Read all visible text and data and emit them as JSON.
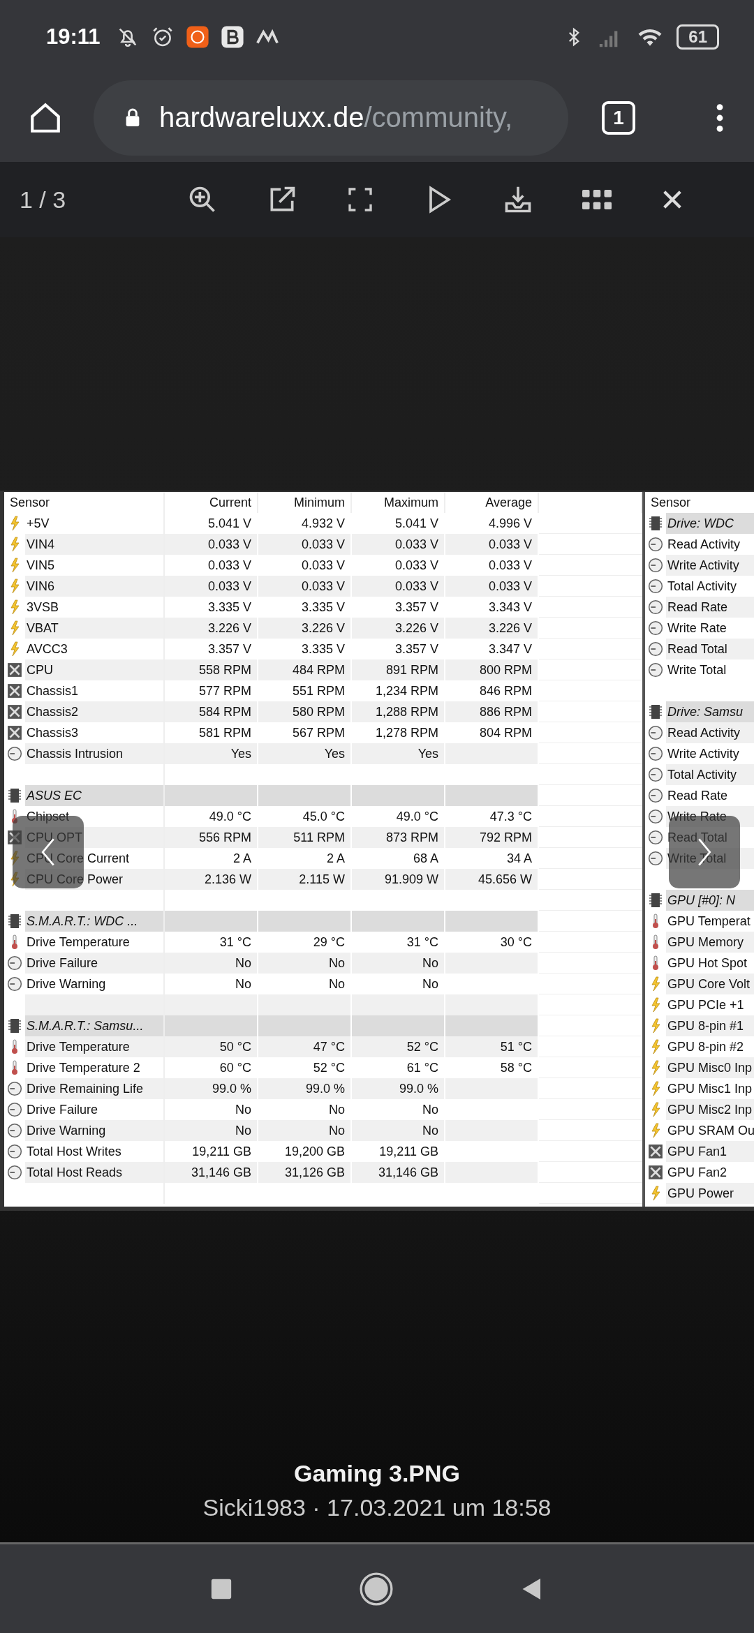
{
  "status_bar": {
    "time": "19:11",
    "battery": "61"
  },
  "address_bar": {
    "domain": "hardwareluxx.de",
    "path": "/community,",
    "tab_count": "1"
  },
  "viewer": {
    "counter": "1 / 3",
    "caption": "Gaming 3.PNG",
    "meta": "Sicki1983 · 17.03.2021 um 18:58"
  },
  "left_panel": {
    "columns": [
      "Sensor",
      "Current",
      "Minimum",
      "Maximum",
      "Average"
    ],
    "rows": [
      {
        "kind": "voltage",
        "name": "+5V",
        "values": [
          "5.041 V",
          "4.932 V",
          "5.041 V",
          "4.996 V"
        ]
      },
      {
        "kind": "voltage",
        "name": "VIN4",
        "values": [
          "0.033 V",
          "0.033 V",
          "0.033 V",
          "0.033 V"
        ]
      },
      {
        "kind": "voltage",
        "name": "VIN5",
        "values": [
          "0.033 V",
          "0.033 V",
          "0.033 V",
          "0.033 V"
        ]
      },
      {
        "kind": "voltage",
        "name": "VIN6",
        "values": [
          "0.033 V",
          "0.033 V",
          "0.033 V",
          "0.033 V"
        ]
      },
      {
        "kind": "voltage",
        "name": "3VSB",
        "values": [
          "3.335 V",
          "3.335 V",
          "3.357 V",
          "3.343 V"
        ]
      },
      {
        "kind": "voltage",
        "name": "VBAT",
        "values": [
          "3.226 V",
          "3.226 V",
          "3.226 V",
          "3.226 V"
        ]
      },
      {
        "kind": "voltage",
        "name": "AVCC3",
        "values": [
          "3.357 V",
          "3.335 V",
          "3.357 V",
          "3.347 V"
        ]
      },
      {
        "kind": "fan",
        "name": "CPU",
        "values": [
          "558 RPM",
          "484 RPM",
          "891 RPM",
          "800 RPM"
        ]
      },
      {
        "kind": "fan",
        "name": "Chassis1",
        "values": [
          "577 RPM",
          "551 RPM",
          "1,234 RPM",
          "846 RPM"
        ]
      },
      {
        "kind": "fan",
        "name": "Chassis2",
        "values": [
          "584 RPM",
          "580 RPM",
          "1,288 RPM",
          "886 RPM"
        ]
      },
      {
        "kind": "fan",
        "name": "Chassis3",
        "values": [
          "581 RPM",
          "567 RPM",
          "1,278 RPM",
          "804 RPM"
        ]
      },
      {
        "kind": "status",
        "name": "Chassis Intrusion",
        "values": [
          "Yes",
          "Yes",
          "Yes"
        ]
      },
      {
        "kind": "blank"
      },
      {
        "kind": "group",
        "name": "ASUS EC"
      },
      {
        "kind": "temperature",
        "name": "Chipset",
        "values": [
          "49.0 °C",
          "45.0 °C",
          "49.0 °C",
          "47.3 °C"
        ]
      },
      {
        "kind": "fan",
        "name": "CPU OPT",
        "values": [
          "556 RPM",
          "511 RPM",
          "873 RPM",
          "792 RPM"
        ]
      },
      {
        "kind": "voltage",
        "name": "CPU Core Current",
        "values": [
          "2 A",
          "2 A",
          "68 A",
          "34 A"
        ]
      },
      {
        "kind": "voltage",
        "name": "CPU Core Power",
        "values": [
          "2.136 W",
          "2.115 W",
          "91.909 W",
          "45.656 W"
        ]
      },
      {
        "kind": "blank"
      },
      {
        "kind": "group",
        "name": "S.M.A.R.T.: WDC ..."
      },
      {
        "kind": "temperature",
        "name": "Drive Temperature",
        "values": [
          "31 °C",
          "29 °C",
          "31 °C",
          "30 °C"
        ]
      },
      {
        "kind": "status",
        "name": "Drive Failure",
        "values": [
          "No",
          "No",
          "No"
        ]
      },
      {
        "kind": "status",
        "name": "Drive Warning",
        "values": [
          "No",
          "No",
          "No"
        ]
      },
      {
        "kind": "blank"
      },
      {
        "kind": "group",
        "name": "S.M.A.R.T.: Samsu..."
      },
      {
        "kind": "temperature",
        "name": "Drive Temperature",
        "values": [
          "50 °C",
          "47 °C",
          "52 °C",
          "51 °C"
        ]
      },
      {
        "kind": "temperature",
        "name": "Drive Temperature 2",
        "values": [
          "60 °C",
          "52 °C",
          "61 °C",
          "58 °C"
        ]
      },
      {
        "kind": "status",
        "name": "Drive Remaining Life",
        "values": [
          "99.0 %",
          "99.0 %",
          "99.0 %"
        ]
      },
      {
        "kind": "status",
        "name": "Drive Failure",
        "values": [
          "No",
          "No",
          "No"
        ]
      },
      {
        "kind": "status",
        "name": "Drive Warning",
        "values": [
          "No",
          "No",
          "No"
        ]
      },
      {
        "kind": "status",
        "name": "Total Host Writes",
        "values": [
          "19,211 GB",
          "19,200 GB",
          "19,211 GB"
        ]
      },
      {
        "kind": "status",
        "name": "Total Host Reads",
        "values": [
          "31,146 GB",
          "31,126 GB",
          "31,146 GB"
        ]
      },
      {
        "kind": "blank"
      }
    ]
  },
  "right_panel": {
    "columns": [
      "Sensor"
    ],
    "rows": [
      {
        "kind": "group",
        "name": "Drive: WDC"
      },
      {
        "kind": "status",
        "name": "Read Activity"
      },
      {
        "kind": "status",
        "name": "Write Activity"
      },
      {
        "kind": "status",
        "name": "Total Activity"
      },
      {
        "kind": "status",
        "name": "Read Rate"
      },
      {
        "kind": "status",
        "name": "Write Rate"
      },
      {
        "kind": "status",
        "name": "Read Total"
      },
      {
        "kind": "status",
        "name": "Write Total"
      },
      {
        "kind": "blank"
      },
      {
        "kind": "group",
        "name": "Drive: Samsu"
      },
      {
        "kind": "status",
        "name": "Read Activity"
      },
      {
        "kind": "status",
        "name": "Write Activity"
      },
      {
        "kind": "status",
        "name": "Total Activity"
      },
      {
        "kind": "status",
        "name": "Read Rate"
      },
      {
        "kind": "status",
        "name": "Write Rate"
      },
      {
        "kind": "status",
        "name": "Read Total"
      },
      {
        "kind": "status",
        "name": "Write Total"
      },
      {
        "kind": "blank"
      },
      {
        "kind": "group",
        "name": "GPU [#0]: N"
      },
      {
        "kind": "temperature",
        "name": "GPU Temperat"
      },
      {
        "kind": "temperature",
        "name": "GPU Memory"
      },
      {
        "kind": "temperature",
        "name": "GPU Hot Spot"
      },
      {
        "kind": "voltage",
        "name": "GPU Core Volt"
      },
      {
        "kind": "voltage",
        "name": "GPU PCIe +1"
      },
      {
        "kind": "voltage",
        "name": "GPU 8-pin #1"
      },
      {
        "kind": "voltage",
        "name": "GPU 8-pin #2"
      },
      {
        "kind": "voltage",
        "name": "GPU Misc0 Inp"
      },
      {
        "kind": "voltage",
        "name": "GPU Misc1 Inp"
      },
      {
        "kind": "voltage",
        "name": "GPU Misc2 Inp"
      },
      {
        "kind": "voltage",
        "name": "GPU SRAM Ou"
      },
      {
        "kind": "fan",
        "name": "GPU Fan1"
      },
      {
        "kind": "fan",
        "name": "GPU Fan2"
      },
      {
        "kind": "voltage",
        "name": "GPU Power"
      }
    ]
  }
}
